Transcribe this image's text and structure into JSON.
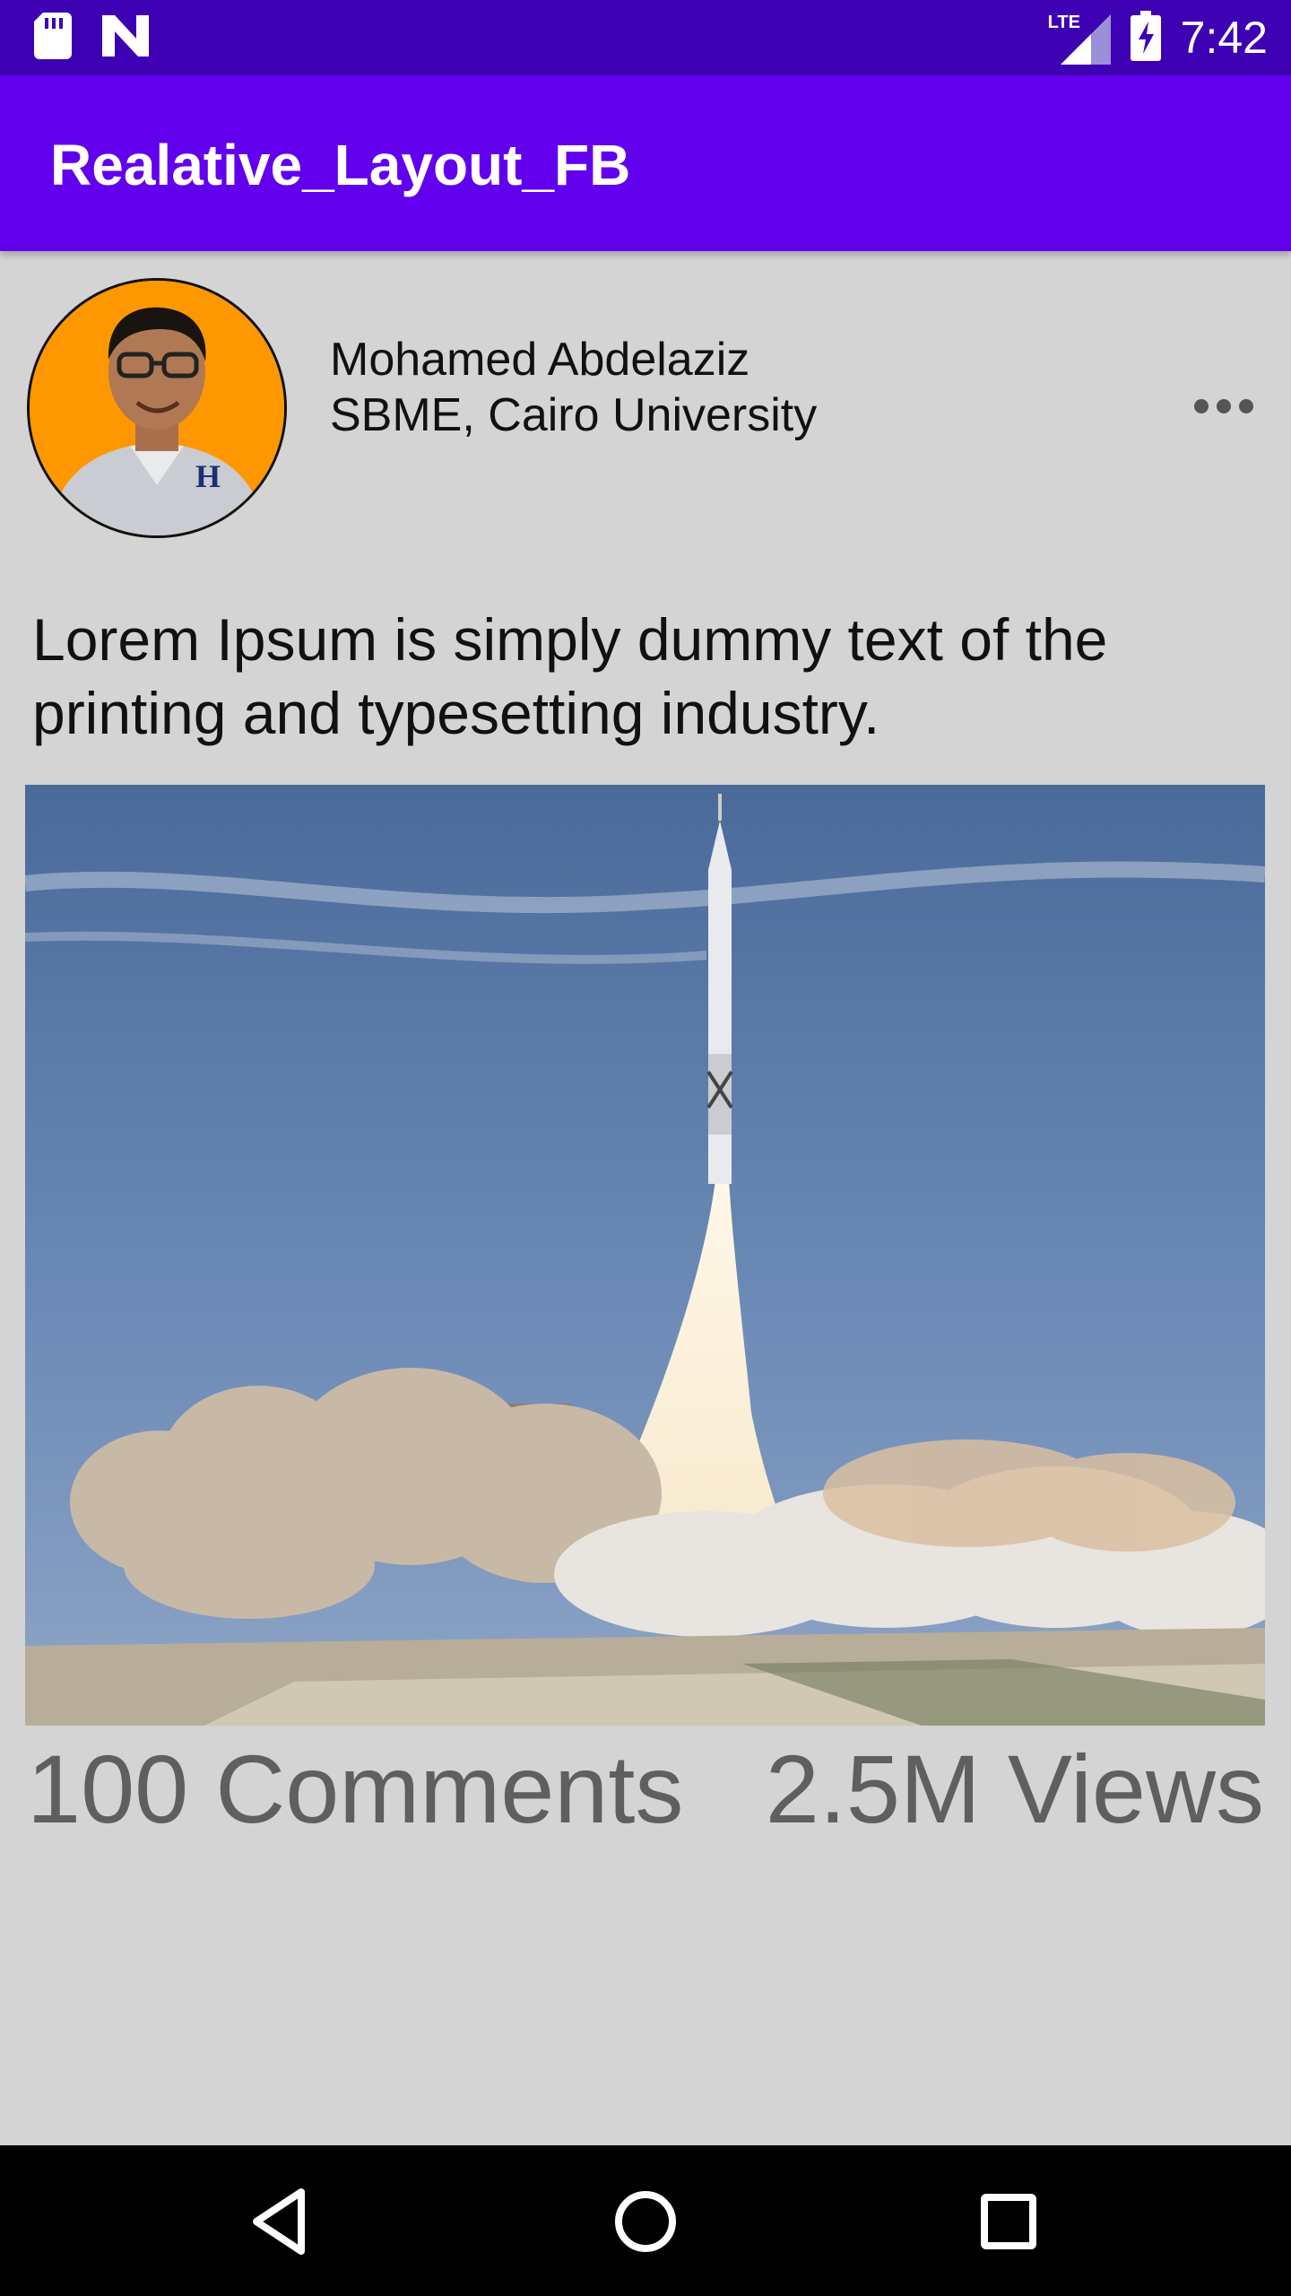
{
  "status_bar": {
    "time": "7:42",
    "network_label": "LTE",
    "icons": [
      "sd-card-icon",
      "n-logo-icon",
      "signal-icon",
      "battery-charging-icon"
    ]
  },
  "app_bar": {
    "title": "Realative_Layout_FB",
    "color": "#6200ee"
  },
  "post": {
    "author_name": "Mohamed Abdelaziz",
    "author_org": "SBME, Cairo University",
    "more_icon": "more-horizontal-icon",
    "text": "Lorem Ipsum is simply dummy text of the printing and typesetting industry.",
    "image_subject": "rocket-launch-image",
    "comments": "100 Comments",
    "views": "2.5M Views"
  },
  "nav_bar": {
    "icons": [
      "back-icon",
      "home-icon",
      "recents-icon"
    ]
  }
}
